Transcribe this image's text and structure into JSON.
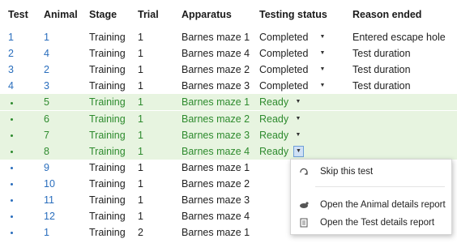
{
  "header": {
    "test": "Test",
    "animal": "Animal",
    "stage": "Stage",
    "trial": "Trial",
    "apparatus": "Apparatus",
    "status": "Testing status",
    "reason": "Reason ended"
  },
  "rows": [
    {
      "test": "1",
      "animal": "1",
      "stage": "Training",
      "trial": "1",
      "apparatus": "Barnes maze 1",
      "status": "Completed",
      "reason": "Entered escape hole"
    },
    {
      "test": "2",
      "animal": "4",
      "stage": "Training",
      "trial": "1",
      "apparatus": "Barnes maze 4",
      "status": "Completed",
      "reason": "Test duration"
    },
    {
      "test": "3",
      "animal": "2",
      "stage": "Training",
      "trial": "1",
      "apparatus": "Barnes maze 2",
      "status": "Completed",
      "reason": "Test duration"
    },
    {
      "test": "4",
      "animal": "3",
      "stage": "Training",
      "trial": "1",
      "apparatus": "Barnes maze 3",
      "status": "Completed",
      "reason": "Test duration"
    },
    {
      "test": "",
      "animal": "5",
      "stage": "Training",
      "trial": "1",
      "apparatus": "Barnes maze 1",
      "status": "Ready",
      "reason": ""
    },
    {
      "test": "",
      "animal": "6",
      "stage": "Training",
      "trial": "1",
      "apparatus": "Barnes maze 2",
      "status": "Ready",
      "reason": ""
    },
    {
      "test": "",
      "animal": "7",
      "stage": "Training",
      "trial": "1",
      "apparatus": "Barnes maze 3",
      "status": "Ready",
      "reason": ""
    },
    {
      "test": "",
      "animal": "8",
      "stage": "Training",
      "trial": "1",
      "apparatus": "Barnes maze 4",
      "status": "Ready",
      "reason": ""
    },
    {
      "test": "",
      "animal": "9",
      "stage": "Training",
      "trial": "1",
      "apparatus": "Barnes maze 1",
      "status": "",
      "reason": ""
    },
    {
      "test": "",
      "animal": "10",
      "stage": "Training",
      "trial": "1",
      "apparatus": "Barnes maze 2",
      "status": "",
      "reason": ""
    },
    {
      "test": "",
      "animal": "11",
      "stage": "Training",
      "trial": "1",
      "apparatus": "Barnes maze 3",
      "status": "",
      "reason": ""
    },
    {
      "test": "",
      "animal": "12",
      "stage": "Training",
      "trial": "1",
      "apparatus": "Barnes maze 4",
      "status": "",
      "reason": ""
    },
    {
      "test": "",
      "animal": "1",
      "stage": "Training",
      "trial": "2",
      "apparatus": "Barnes maze 1",
      "status": "",
      "reason": ""
    }
  ],
  "context_menu": {
    "skip": "Skip this test",
    "animal_report": "Open the Animal details report",
    "test_report": "Open the Test details report"
  },
  "colors": {
    "link": "#2a6ebd",
    "ready_text": "#2e8b2e",
    "ready_row_bg": "#e7f4e0",
    "dropdown_active": "#cfe0f5"
  }
}
